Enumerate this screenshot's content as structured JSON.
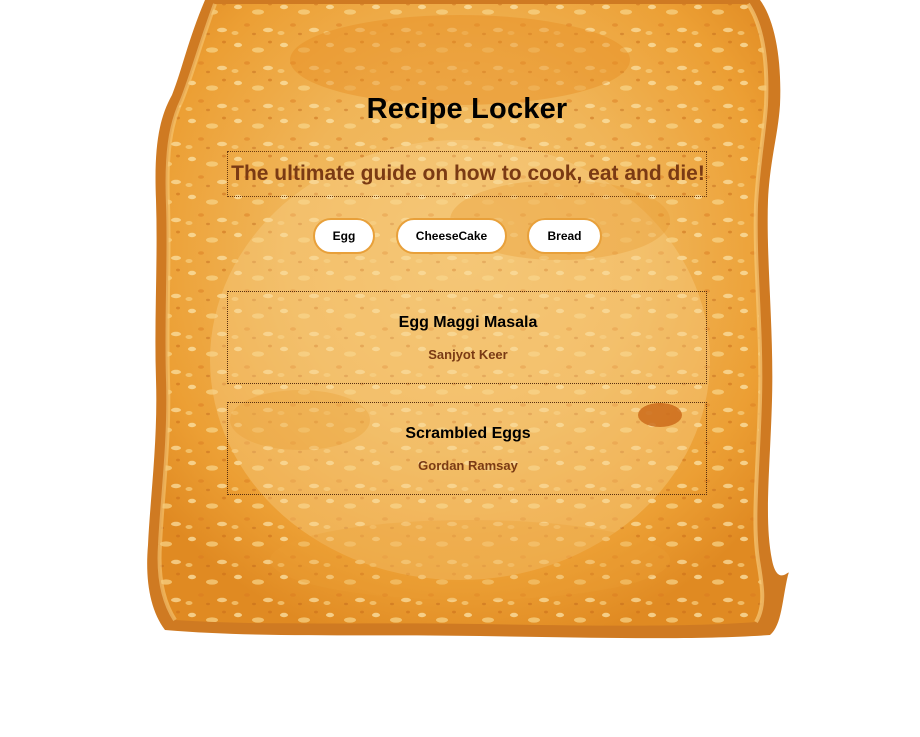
{
  "header": {
    "title": "Recipe Locker",
    "tagline": "The ultimate guide on how to cook, eat and die!"
  },
  "filters": [
    {
      "label": "Egg"
    },
    {
      "label": "CheeseCake"
    },
    {
      "label": "Bread"
    }
  ],
  "recipes": [
    {
      "name": "Egg Maggi Masala",
      "author": "Sanjyot Keer"
    },
    {
      "name": "Scrambled Eggs",
      "author": "Gordan Ramsay"
    }
  ],
  "colors": {
    "crust": "#c9701e",
    "bread": "#f5c46e",
    "accent_text": "#7a3a14",
    "button_border": "#e8a03a"
  },
  "background_image": "toast-slice"
}
